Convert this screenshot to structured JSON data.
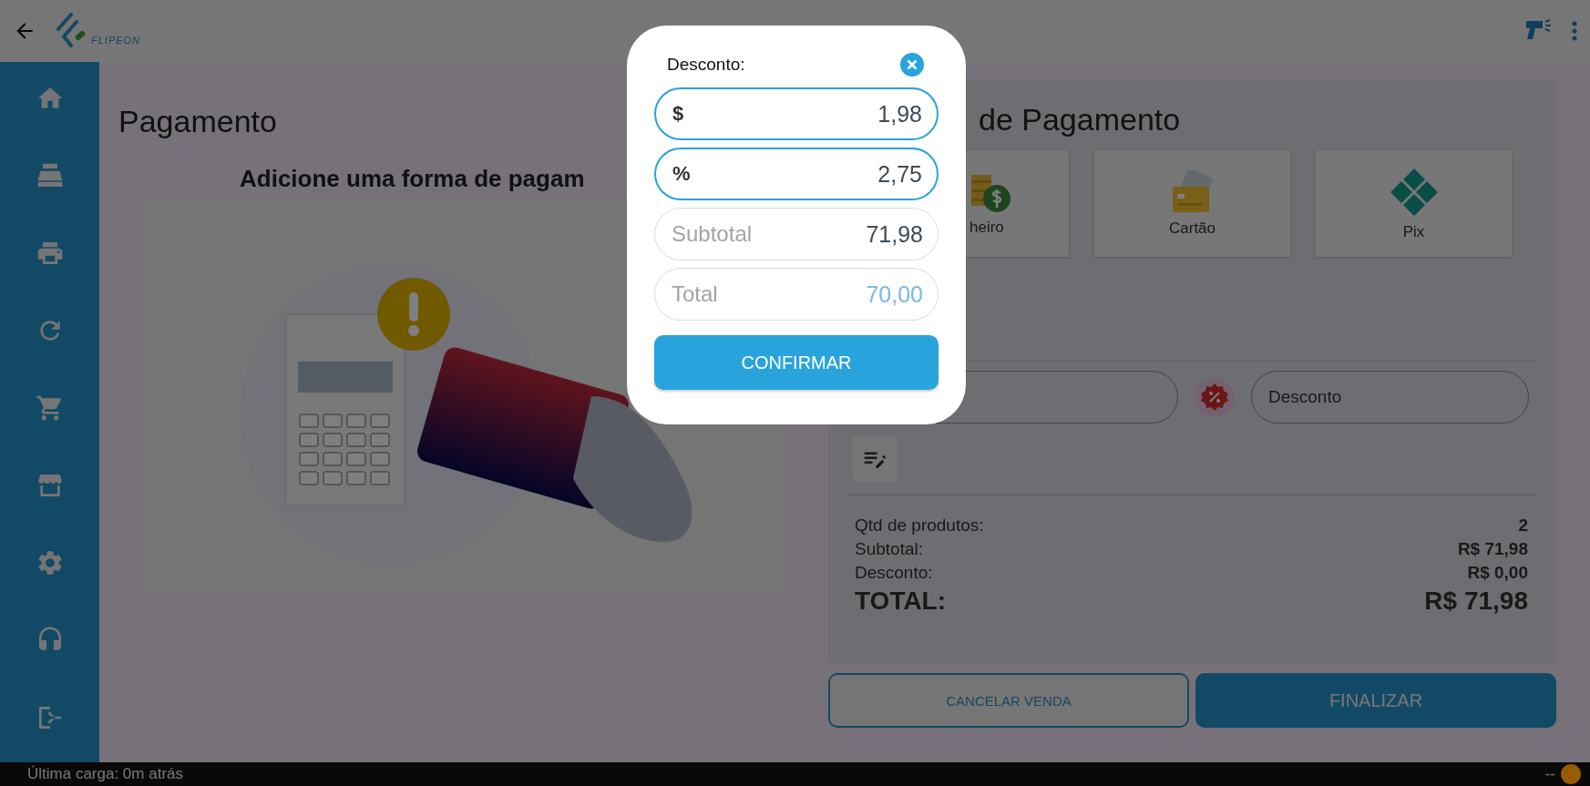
{
  "header": {
    "logo_text": "FLIPEON"
  },
  "left_panel": {
    "title": "Pagamento",
    "subtitle": "Adicione uma forma de pagam"
  },
  "right_panel": {
    "title": "de Pagamento",
    "methods": [
      {
        "label": "heiro",
        "kind": "cash",
        "clipped": true
      },
      {
        "label": "Cartão",
        "kind": "card",
        "clipped": false
      },
      {
        "label": "Pix",
        "kind": "pix",
        "clipped": false
      }
    ],
    "discount_field": {
      "placeholder": "Desconto"
    },
    "summary": [
      {
        "label": "Qtd de produtos:",
        "value": "2",
        "kind": "line"
      },
      {
        "label": "Subtotal:",
        "value": "R$ 71,98",
        "kind": "line"
      },
      {
        "label": "Desconto:",
        "value": "R$ 0,00",
        "kind": "line"
      },
      {
        "label": "TOTAL:",
        "value": "R$ 71,98",
        "kind": "total"
      }
    ]
  },
  "actions": [
    {
      "label": "CANCELAR VENDA",
      "kind": "outline"
    },
    {
      "label": "FINALIZAR",
      "kind": "primary"
    }
  ],
  "modal": {
    "title": "Desconto:",
    "confirm": "CONFIRMAR",
    "fields": [
      {
        "prefix": "$",
        "value": "1,98",
        "kind": "editable"
      },
      {
        "prefix": "%",
        "value": "2,75",
        "kind": "editable"
      },
      {
        "label": "Subtotal",
        "value": "71,98",
        "kind": "readonly"
      },
      {
        "label": "Total",
        "value": "70,00",
        "kind": "result"
      }
    ]
  },
  "status_bar": {
    "text": "Última carga: 0m atrás",
    "indicator": "--",
    "color": "#985c00"
  }
}
